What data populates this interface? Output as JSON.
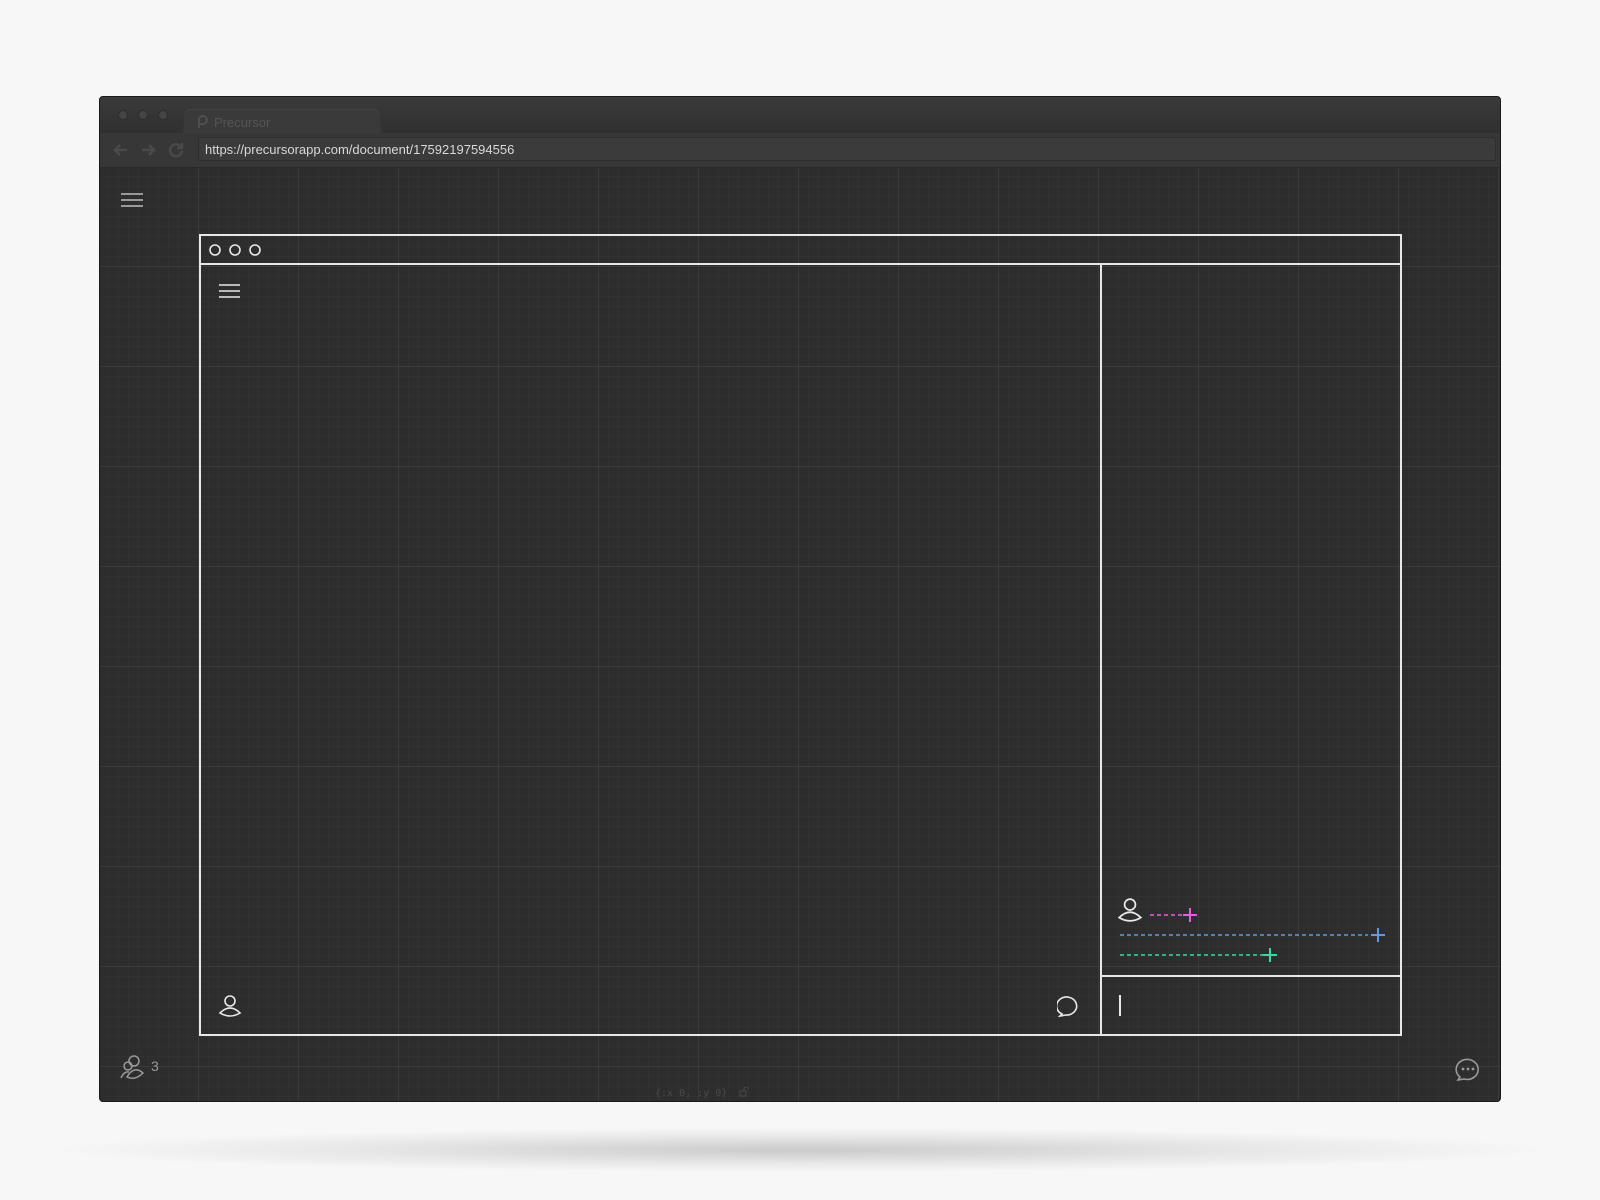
{
  "browser": {
    "tab_title": "Precursor",
    "url": "https://precursorapp.com/document/17592197594556"
  },
  "app": {
    "menu_icon": "hamburger-icon",
    "collaborators_icon": "users-icon",
    "collaborators_count": "3",
    "chat_icon": "chat-bubble-icon",
    "coordinates": "{:x 0, :y 0}",
    "coordinates_lock_icon": "unlock-icon"
  },
  "mockup": {
    "window_dots_icon": "circle-icon",
    "menu_icon": "hamburger-icon",
    "user_icon": "user-icon",
    "chat_icon": "speech-bubble-icon",
    "cursor_colors": [
      "#e85ce0",
      "#5b9be8",
      "#3ed6a2"
    ],
    "cursor_icon": "crosshair-icon"
  }
}
